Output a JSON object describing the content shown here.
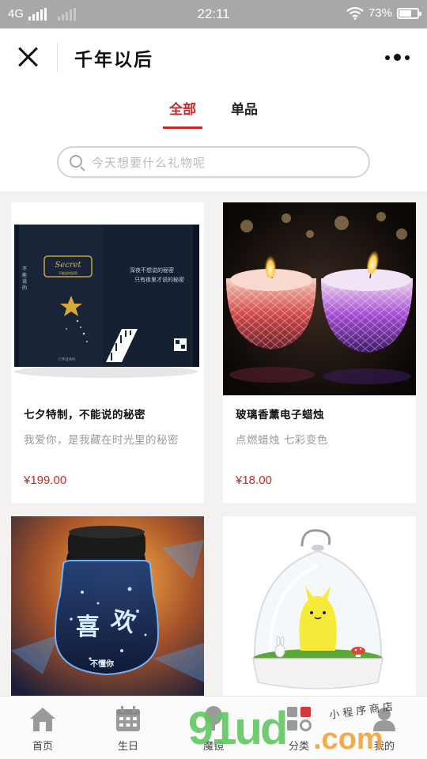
{
  "status_bar": {
    "network": "4G",
    "time": "22:11",
    "battery": "73%",
    "battery_level": 0.73
  },
  "nav": {
    "title": "千年以后"
  },
  "tabs": [
    {
      "label": "全部",
      "active": true
    },
    {
      "label": "单品",
      "active": false
    }
  ],
  "search": {
    "placeholder": "今天想要什么礼物呢"
  },
  "products": [
    {
      "name": "七夕特制，不能说的秘密",
      "desc": "我爱你，是我藏在时光里的秘密",
      "price": "¥199.00",
      "image": "notebook-photo"
    },
    {
      "name": "玻璃香薰电子蜡烛",
      "desc": "点燃蜡烛 七彩变色",
      "price": "¥18.00",
      "image": "candle-photo"
    },
    {
      "name": "",
      "desc": "",
      "price": "",
      "image": "star-jar-lamp-photo"
    },
    {
      "name": "",
      "desc": "",
      "price": "",
      "image": "totoro-night-light-photo"
    }
  ],
  "bottom_tabs": [
    {
      "label": "首页",
      "icon": "home-icon"
    },
    {
      "label": "生日",
      "icon": "calendar-icon"
    },
    {
      "label": "魔镜",
      "icon": "mirror-icon"
    },
    {
      "label": "分类",
      "icon": "category-icon"
    },
    {
      "label": "我的",
      "icon": "profile-icon"
    }
  ],
  "watermark": {
    "text": "91ud",
    "domain": ".com",
    "caption": "小程序商店"
  },
  "colors": {
    "accent": "#c8282a",
    "statusbar": "#a8a8a8",
    "background": "#f4f1f1"
  }
}
